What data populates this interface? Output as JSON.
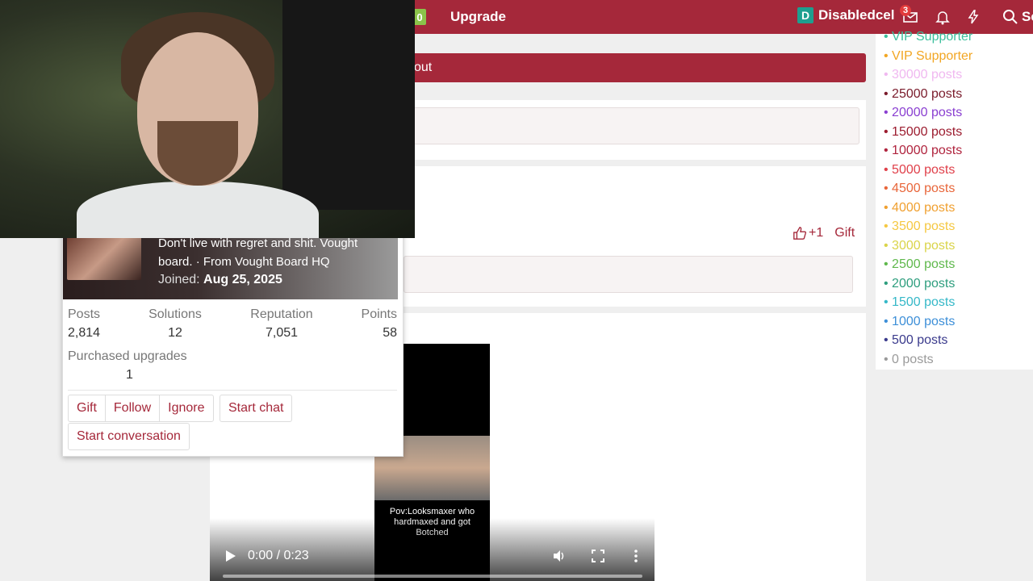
{
  "navbar": {
    "green_badge": "0",
    "upgrade_label": "Upgrade",
    "user_initial": "D",
    "username": "Disabledcel",
    "messages_badge": "3",
    "search_label": "Se"
  },
  "thread": {
    "redbar_text": "out",
    "reactions": {
      "like_label": "+1",
      "gift_label": "Gift"
    }
  },
  "sidebar": {
    "items": [
      {
        "label": "• VIP Supporter",
        "color": "#3bbf9c"
      },
      {
        "label": "• VIP Supporter",
        "color": "#f2a623"
      },
      {
        "label": "• 30000 posts",
        "color": "#f0b8f0"
      },
      {
        "label": "• 25000 posts",
        "color": "#7a1b2b"
      },
      {
        "label": "• 20000 posts",
        "color": "#8a3fd1"
      },
      {
        "label": "• 15000 posts",
        "color": "#9c1c2f"
      },
      {
        "label": "• 10000 posts",
        "color": "#b0243e"
      },
      {
        "label": "• 5000 posts",
        "color": "#e0404a"
      },
      {
        "label": "• 4500 posts",
        "color": "#e8663a"
      },
      {
        "label": "• 4000 posts",
        "color": "#f0a030"
      },
      {
        "label": "• 3500 posts",
        "color": "#f5c842"
      },
      {
        "label": "• 3000 posts",
        "color": "#dad44a"
      },
      {
        "label": "• 2500 posts",
        "color": "#5fb84c"
      },
      {
        "label": "• 2000 posts",
        "color": "#2e9e7e"
      },
      {
        "label": "• 1500 posts",
        "color": "#35b8c8"
      },
      {
        "label": "• 1000 posts",
        "color": "#3d8fd8"
      },
      {
        "label": "• 500 posts",
        "color": "#3a3a8c"
      },
      {
        "label": "• 0 posts",
        "color": "#9a9a9a"
      }
    ]
  },
  "profile": {
    "bio_line1": "Don't live with regret and shit. Vought",
    "bio_line2": "board. · From Vought Board HQ",
    "joined_label": "Joined:",
    "joined_date": "Aug 25, 2025",
    "stats": {
      "posts_label": "Posts",
      "posts": "2,814",
      "solutions_label": "Solutions",
      "solutions": "12",
      "reputation_label": "Reputation",
      "reputation": "7,051",
      "points_label": "Points",
      "points": "58",
      "upgrades_label": "Purchased upgrades",
      "upgrades": "1"
    },
    "buttons": {
      "gift": "Gift",
      "follow": "Follow",
      "ignore": "Ignore",
      "start_chat": "Start chat",
      "start_conversation": "Start conversation"
    }
  },
  "video": {
    "caption": "Pov:Looksmaxer who hardmaxed and got Botched",
    "time": "0:00 / 0:23",
    "progress": 0
  }
}
